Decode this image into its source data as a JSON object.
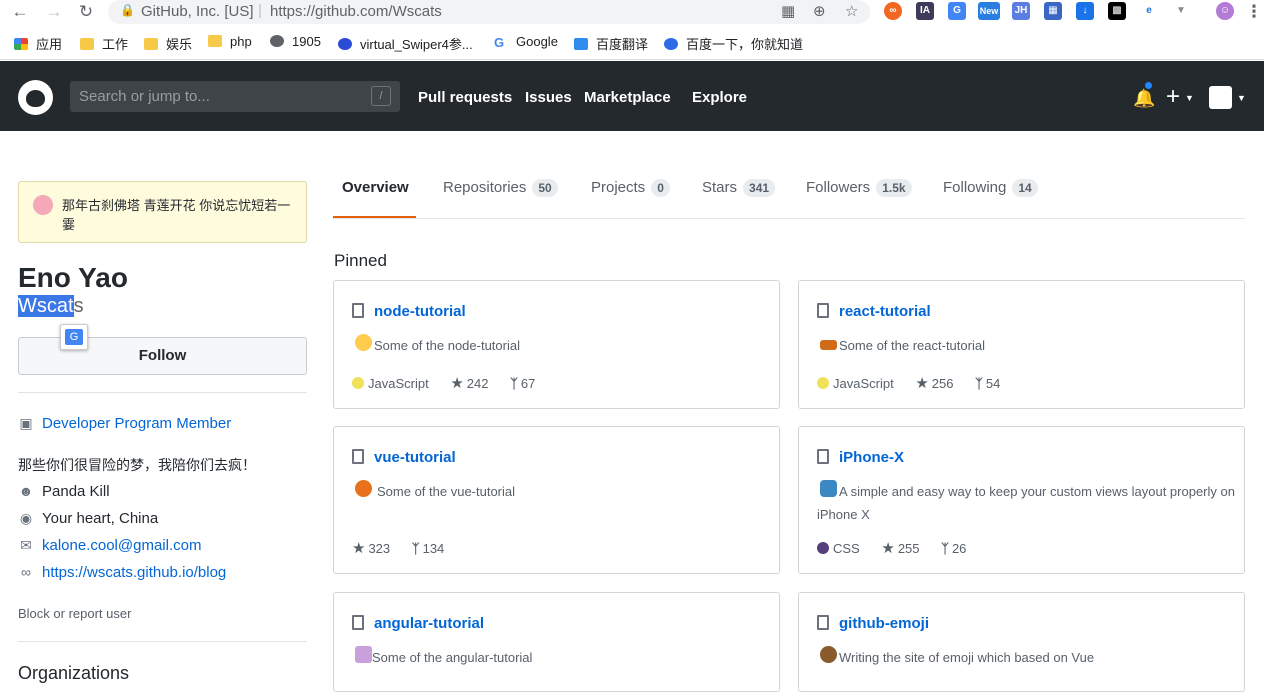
{
  "browser": {
    "url_org": "GitHub, Inc. [US]",
    "url_separator": "|",
    "url": "https://github.com/Wscats",
    "bookmarks": [
      "应用",
      "工作",
      "娱乐",
      "php",
      "1905",
      "virtual_Swiper4参...",
      "Google",
      "百度翻译",
      "百度一下，你就知道"
    ],
    "extensions": [
      "IA",
      "New",
      "JH"
    ]
  },
  "header": {
    "search_placeholder": "Search or jump to...",
    "search_shortcut": "/",
    "nav": [
      "Pull requests",
      "Issues",
      "Marketplace",
      "Explore"
    ]
  },
  "profile": {
    "status": "那年古刹佛塔 青莲开花 你说忘忧短若一霎",
    "name": "Eno Yao",
    "login_selected": "Wscat",
    "login_rest": "s",
    "follow_label": "Follow",
    "badge": "Developer Program Member",
    "bio": "那些你们很冒险的梦，我陪你们去疯！",
    "company": "Panda Kill",
    "location": "Your heart, China",
    "email": "kalone.cool@gmail.com",
    "website": "https://wscats.github.io/blog",
    "block_label": "Block or report user",
    "organizations_heading": "Organizations"
  },
  "tabs": [
    {
      "label": "Overview",
      "count": ""
    },
    {
      "label": "Repositories",
      "count": "50"
    },
    {
      "label": "Projects",
      "count": "0"
    },
    {
      "label": "Stars",
      "count": "341"
    },
    {
      "label": "Followers",
      "count": "1.5k"
    },
    {
      "label": "Following",
      "count": "14"
    }
  ],
  "pinned_heading": "Pinned",
  "pinned": [
    {
      "name": "node-tutorial",
      "desc": "Some of the node-tutorial",
      "lang": "JavaScript",
      "lang_color": "#f1e05a",
      "stars": "242",
      "forks": "67"
    },
    {
      "name": "react-tutorial",
      "desc": "Some of the react-tutorial",
      "lang": "JavaScript",
      "lang_color": "#f1e05a",
      "stars": "256",
      "forks": "54"
    },
    {
      "name": "vue-tutorial",
      "desc": "Some of the vue-tutorial",
      "lang": "",
      "lang_color": "",
      "stars": "323",
      "forks": "134"
    },
    {
      "name": "iPhone-X",
      "desc": "A simple and easy way to keep your custom views layout properly on iPhone X",
      "lang": "CSS",
      "lang_color": "#563d7c",
      "stars": "255",
      "forks": "26"
    },
    {
      "name": "angular-tutorial",
      "desc": "Some of the angular-tutorial"
    },
    {
      "name": "github-emoji",
      "desc": "Writing the site of emoji which based on Vue"
    }
  ]
}
